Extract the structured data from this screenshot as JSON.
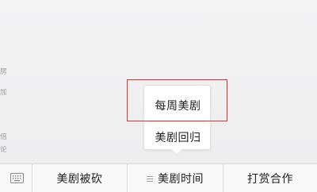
{
  "left_edge": {
    "glyphs": [
      "房",
      "加",
      "倍",
      "论"
    ]
  },
  "popup": {
    "items": [
      {
        "label": "每周美剧"
      },
      {
        "label": "美剧回归"
      }
    ]
  },
  "menubar": {
    "keyboard_icon": "keyboard-icon",
    "items": [
      {
        "label": "美剧被砍"
      },
      {
        "label": "美剧时间",
        "icon": "submenu-lines-icon"
      },
      {
        "label": "打赏合作"
      }
    ]
  },
  "colors": {
    "highlight": "#e2322b",
    "background": "#efeff0",
    "menubar": "#f8f8f8"
  }
}
